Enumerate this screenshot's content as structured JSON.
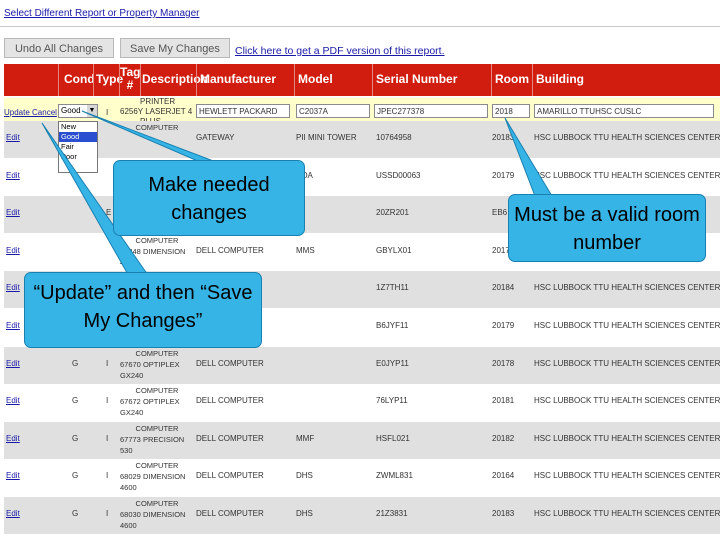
{
  "top_link": "Select Different Report or Property Manager",
  "buttons": {
    "undo": "Undo All Changes",
    "save": "Save My Changes"
  },
  "pdf_link": "Click here to get a PDF version of this report.",
  "headers": [
    "Cond",
    "Type",
    "Tag #",
    "Description",
    "Manufacturer",
    "Model",
    "Serial Number",
    "Room",
    "Building"
  ],
  "edit_row": {
    "update_cancel": "Update Cancel",
    "cond_value": "Good",
    "type": "I",
    "tag_desc": [
      "PRINTER",
      "6256Y LASERJET 4",
      "PLUS"
    ],
    "manufacturer": "HEWLETT PACKARD",
    "model": "C2037A",
    "serial": "JPEC277378",
    "room": "2018",
    "building": "AMARILLO TTUHSC CUSLC"
  },
  "cond_options": [
    "New",
    "Good",
    "Fair",
    "Poor"
  ],
  "rows": [
    {
      "edit": "Edit",
      "cond": "",
      "type": "",
      "tag_desc": [
        "COMPUTER"
      ],
      "manufacturer": "GATEWAY",
      "model": "PII MINI TOWER",
      "serial": "10764958",
      "room": "20183",
      "building": "HSC LUBBOCK TTU HEALTH SCIENCES CENTER"
    },
    {
      "edit": "Edit",
      "cond": "F",
      "type": "",
      "tag_desc": [],
      "manufacturer": "",
      "model": "POA",
      "serial": "USSD00063",
      "room": "20179",
      "building": "HSC LUBBOCK TTU HEALTH SCIENCES CENTER"
    },
    {
      "edit": "Edit",
      "cond": "",
      "type": "E",
      "tag_desc": [],
      "manufacturer": "",
      "model": "L",
      "serial": "20ZR201",
      "room": "EB6",
      "building": ""
    },
    {
      "edit": "Edit",
      "cond": "",
      "type": "",
      "tag_desc": [
        "COMPUTER",
        "64848 DIMENSION",
        "4100"
      ],
      "manufacturer": "DELL COMPUTER",
      "model": "MMS",
      "serial": "GBYLX01",
      "room": "2017",
      "building": ""
    },
    {
      "edit": "Edit",
      "cond": "",
      "type": "",
      "tag_desc": [],
      "manufacturer": "",
      "model": "",
      "serial": "1Z7TH11",
      "room": "20184",
      "building": "HSC LUBBOCK TTU HEALTH SCIENCES CENTER"
    },
    {
      "edit": "Edit",
      "cond": "",
      "type": "",
      "tag_desc": [],
      "manufacturer": "",
      "model": "",
      "serial": "B6JYF11",
      "room": "20179",
      "building": "HSC LUBBOCK TTU HEALTH SCIENCES CENTER"
    },
    {
      "edit": "Edit",
      "cond": "G",
      "type": "I",
      "tag_desc": [
        "COMPUTER",
        "67670 OPTIPLEX",
        "GX240"
      ],
      "manufacturer": "DELL COMPUTER",
      "model": "",
      "serial": "E0JYP11",
      "room": "20178",
      "building": "HSC LUBBOCK TTU HEALTH SCIENCES CENTER"
    },
    {
      "edit": "Edit",
      "cond": "G",
      "type": "I",
      "tag_desc": [
        "COMPUTER",
        "67672 OPTIPLEX",
        "GX240"
      ],
      "manufacturer": "DELL COMPUTER",
      "model": "",
      "serial": "76LYP11",
      "room": "20181",
      "building": "HSC LUBBOCK TTU HEALTH SCIENCES CENTER"
    },
    {
      "edit": "Edit",
      "cond": "G",
      "type": "I",
      "tag_desc": [
        "COMPUTER",
        "67773 PRECISION",
        "530"
      ],
      "manufacturer": "DELL COMPUTER",
      "model": "MMF",
      "serial": "HSFL021",
      "room": "20182",
      "building": "HSC LUBBOCK TTU HEALTH SCIENCES CENTER"
    },
    {
      "edit": "Edit",
      "cond": "G",
      "type": "I",
      "tag_desc": [
        "COMPUTER",
        "68029 DIMENSION",
        "4600"
      ],
      "manufacturer": "DELL COMPUTER",
      "model": "DHS",
      "serial": "ZWML831",
      "room": "20164",
      "building": "HSC LUBBOCK TTU HEALTH SCIENCES CENTER"
    },
    {
      "edit": "Edit",
      "cond": "G",
      "type": "I",
      "tag_desc": [
        "COMPUTER",
        "68030 DIMENSION",
        "4600"
      ],
      "manufacturer": "DELL COMPUTER",
      "model": "DHS",
      "serial": "21Z3831",
      "room": "20183",
      "building": "HSC LUBBOCK TTU HEALTH SCIENCES CENTER"
    }
  ],
  "callouts": {
    "make_changes": "Make needed changes",
    "update_save": "“Update” and then “Save My Changes”",
    "valid_room": "Must be a valid room number"
  },
  "colors": {
    "header": "#d11d0f",
    "row_alt": "#e0e0e0",
    "edit_row": "#ffffcc",
    "callout": "#36b4e6",
    "link": "#1a1aa8"
  }
}
